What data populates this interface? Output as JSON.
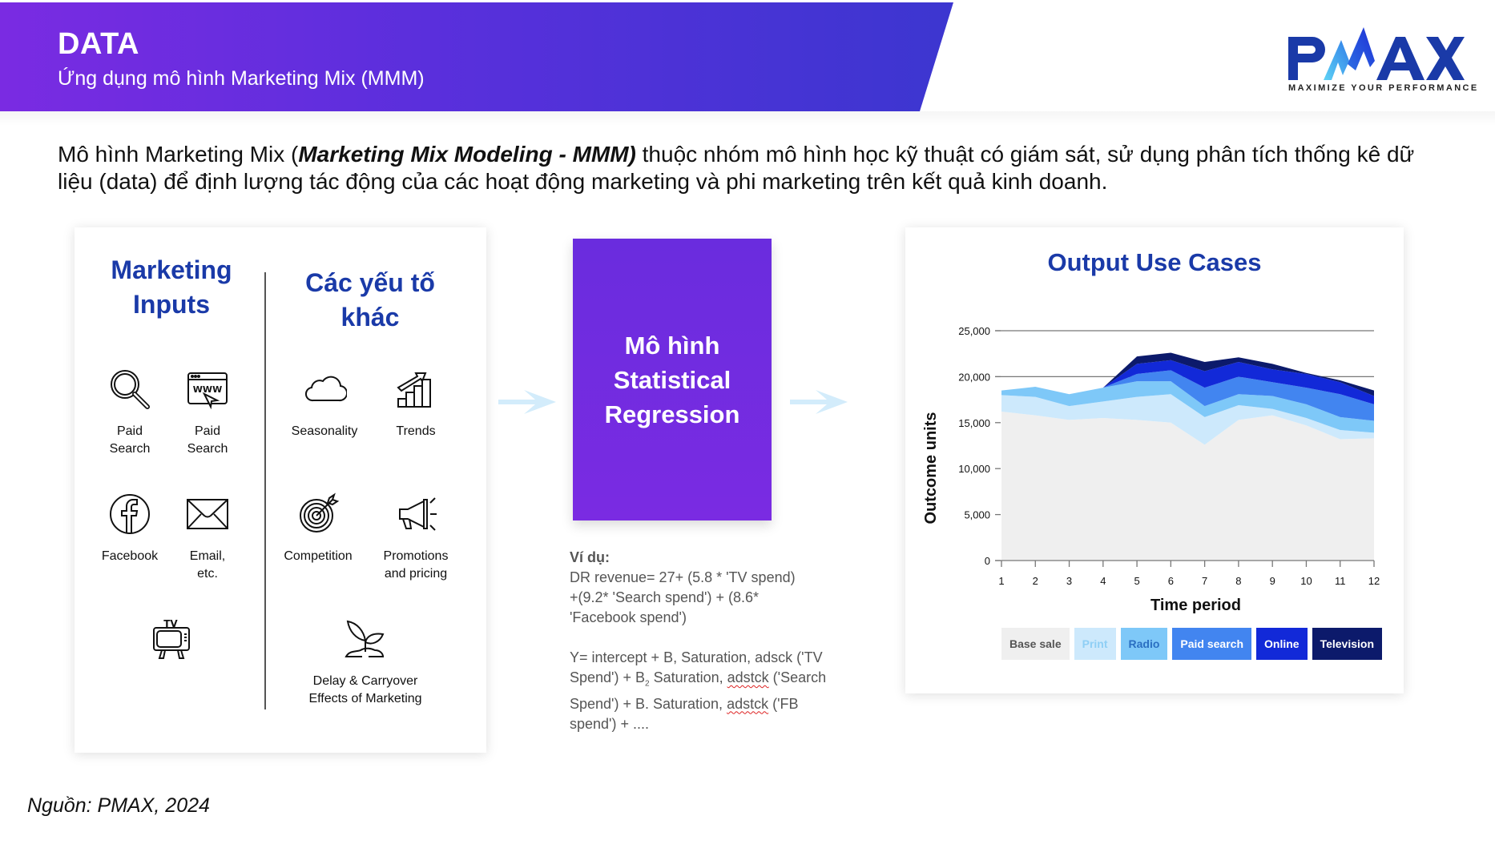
{
  "header": {
    "title": "DATA",
    "subtitle": "Ứng dụng mô hình Marketing Mix (MMM)"
  },
  "logo": {
    "text": "PMAX",
    "tagline": "MAXIMIZE YOUR PERFORMANCE"
  },
  "intro": {
    "prefix": "Mô hình Marketing Mix (",
    "emphasis": "Marketing Mix Modeling - MMM)",
    "suffix": " thuộc nhóm mô hình học kỹ thuật có giám sát, sử dụng phân tích thống kê dữ liệu (data) để định lượng tác động của các hoạt động marketing và phi marketing trên kết quả kinh doanh."
  },
  "inputs_card": {
    "marketing_title_line1": "Marketing",
    "marketing_title_line2": "Inputs",
    "other_title_line1": "Các yếu tố",
    "other_title_line2": "khác",
    "marketing_items": [
      {
        "label_line1": "Paid",
        "label_line2": "Search",
        "icon": "magnifier-icon"
      },
      {
        "label_line1": "Paid",
        "label_line2": "Search",
        "icon": "browser-www-icon"
      },
      {
        "label_line1": "Facebook",
        "label_line2": "",
        "icon": "facebook-icon"
      },
      {
        "label_line1": "Email,",
        "label_line2": "etc.",
        "icon": "envelope-icon"
      },
      {
        "label_line1": "",
        "label_line2": "",
        "icon": "tv-icon",
        "icon_text": "TV"
      }
    ],
    "other_items": [
      {
        "label_line1": "Seasonality",
        "label_line2": "",
        "icon": "cloud-icon"
      },
      {
        "label_line1": "Trends",
        "label_line2": "",
        "icon": "trend-chart-icon"
      },
      {
        "label_line1": "Competition",
        "label_line2": "",
        "icon": "target-icon"
      },
      {
        "label_line1": "Promotions",
        "label_line2": "and pricing",
        "icon": "megaphone-icon"
      },
      {
        "label_line1": "Delay & Carryover",
        "label_line2": "Effects of Marketing",
        "icon": "sprout-icon"
      }
    ]
  },
  "model_box": {
    "line1": "Mô hình",
    "line2": "Statistical",
    "line3": "Regression"
  },
  "example": {
    "title": "Ví dụ:",
    "lines_a": [
      "DR revenue= 27+ (5.8 * 'TV spend)",
      "+(9.2* 'Search spend') + (8.6*",
      "'Facebook spend')"
    ],
    "line_b1": "Y= intercept + B, Saturation, adsck ('TV",
    "line_b2_pre": "Spend') + B",
    "line_b2_sub": "2",
    "line_b2_mid": " Saturation, ",
    "line_b2_err": "adstck",
    "line_b2_post": " ('Search",
    "line_b3_pre": "Spend') + B. Saturation, ",
    "line_b3_err": "adstck",
    "line_b3_post": " ('FB",
    "line_b4": "spend') + ...."
  },
  "output_card": {
    "title": "Output Use Cases"
  },
  "chart_data": {
    "type": "area",
    "stacked": true,
    "title": "Output Use Cases",
    "xlabel": "Time period",
    "ylabel": "Outcome units",
    "x": [
      1,
      2,
      3,
      4,
      5,
      6,
      7,
      8,
      9,
      10,
      11,
      12
    ],
    "ylim": [
      0,
      25000
    ],
    "yticks": [
      0,
      5000,
      10000,
      15000,
      20000,
      25000
    ],
    "ytick_labels": [
      "0",
      "5,000",
      "10,000",
      "15,000",
      "20,000",
      "25,000"
    ],
    "grid": "horizontal at 20,000 and 25,000",
    "legend_position": "bottom",
    "series": [
      {
        "name": "Base sale",
        "color": "#efefef",
        "text_color": "#555555",
        "values": [
          16200,
          15800,
          15300,
          15500,
          15300,
          15000,
          12600,
          15300,
          15800,
          14700,
          13200,
          13300
        ]
      },
      {
        "name": "Print",
        "color": "#cde9fc",
        "text_color": "#8fcff5",
        "values": [
          1800,
          2000,
          1500,
          1800,
          2500,
          3100,
          3000,
          1600,
          700,
          800,
          1000,
          600
        ]
      },
      {
        "name": "Radio",
        "color": "#7ec8f8",
        "text_color": "#2a6fc2",
        "values": [
          500,
          1100,
          1300,
          1500,
          1700,
          1400,
          1200,
          1200,
          1400,
          1500,
          1400,
          1300
        ]
      },
      {
        "name": "Paid search",
        "color": "#4285f0",
        "text_color": "#ffffff",
        "values": [
          0,
          0,
          0,
          0,
          800,
          1200,
          2000,
          1900,
          1500,
          1800,
          2500,
          1800
        ]
      },
      {
        "name": "Online",
        "color": "#1229d8",
        "text_color": "#ffffff",
        "values": [
          0,
          0,
          0,
          0,
          1100,
          1100,
          1800,
          1600,
          1400,
          1500,
          1300,
          900
        ]
      },
      {
        "name": "Television",
        "color": "#0c1a6b",
        "text_color": "#ffffff",
        "values": [
          0,
          0,
          0,
          0,
          800,
          800,
          1000,
          500,
          600,
          100,
          200,
          600
        ]
      }
    ]
  },
  "source": {
    "text": "Nguồn: PMAX, 2024"
  }
}
